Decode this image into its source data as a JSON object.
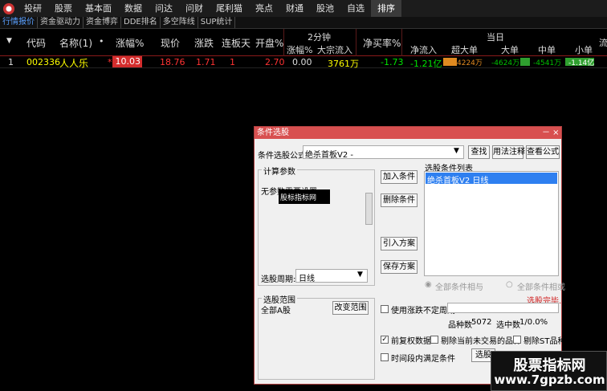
{
  "menubar": {
    "items": [
      "投研",
      "股票",
      "基本面",
      "数据",
      "问达",
      "问财",
      "尾利猫",
      "亮点",
      "财通",
      "股池",
      "自选",
      "排序"
    ]
  },
  "tabs": [
    "行情报价",
    "资金驱动力",
    "资金博弈",
    "DDE排名",
    "多空阵线",
    "SUP统计"
  ],
  "columns": {
    "arrow": "▼",
    "code": "代码",
    "name": "名称(1)",
    "name_dot": "•",
    "change_pct": "涨幅%",
    "price": "现价",
    "change": "涨跌",
    "limit_days": "连板天",
    "open_pct": "开盘%",
    "two_min_group": "2分钟",
    "two_min_change": "涨幅%",
    "block_inflow": "大宗流入",
    "net_buy": "净买率%",
    "today_group": "当日",
    "net_inflow": "净流入",
    "super_large": "超大单",
    "large": "大单",
    "medium": "中单",
    "small": "小单",
    "truncated": "流"
  },
  "row": {
    "index": "1",
    "code": "002336",
    "name": "人人乐",
    "star": "*",
    "change_pct": "10.03",
    "price": "18.76",
    "change": "1.71",
    "limit_days": "1",
    "open_pct": "2.70",
    "two_min_change": "0.00",
    "block_inflow": "3761万",
    "net_buy": "-1.73",
    "net_inflow": "-1.21亿",
    "super_large": "4224万",
    "large": "-4624万",
    "medium": "-4541万",
    "small": "-1.14亿"
  },
  "dialog": {
    "title": "条件选股",
    "controls": "－ ×",
    "formula_label": "条件选股公式",
    "formula_value": "绝杀首板V2  -",
    "find_button": "查找",
    "usage_button": "用法注释",
    "view_button": "查看公式",
    "params_group": "计算参数",
    "params_text": "无参数需要设置",
    "params_overlay": "股标指标网",
    "add_button": "加入条件",
    "delete_button": "删除条件",
    "import_button": "引入方案",
    "save_button": "保存方案",
    "list_title": "选股条件列表",
    "list_item": "绝杀首板V2  日线",
    "period_label": "选股周期:",
    "period_value": "日线",
    "radio_and": "全部条件相与",
    "radio_or": "全部条件相或",
    "status": "选股完毕.",
    "range_group": "选股范围",
    "range_value": "全部A股",
    "change_range_button": "改变范围",
    "use_period_label": "使用涨跌不定周期",
    "count_label": "品种数",
    "count_value": "5072",
    "selected_label": "选中数",
    "selected_value": "1/0.0%",
    "adjusted_label": "前复权数据",
    "adjusted_checked": "✓",
    "remove_untraded_label": "剔除当前未交易的品种",
    "remove_st_label": "剔除ST品种",
    "time_period_label": "时间段内满足条件",
    "select_button": "选股"
  },
  "watermark": {
    "line1": "股票指标网",
    "line2": "www.7gpzb.com"
  },
  "colors": {
    "red": "#ff3232",
    "green": "#00e600",
    "yellow": "#ffff00",
    "accent": "#d85050"
  }
}
